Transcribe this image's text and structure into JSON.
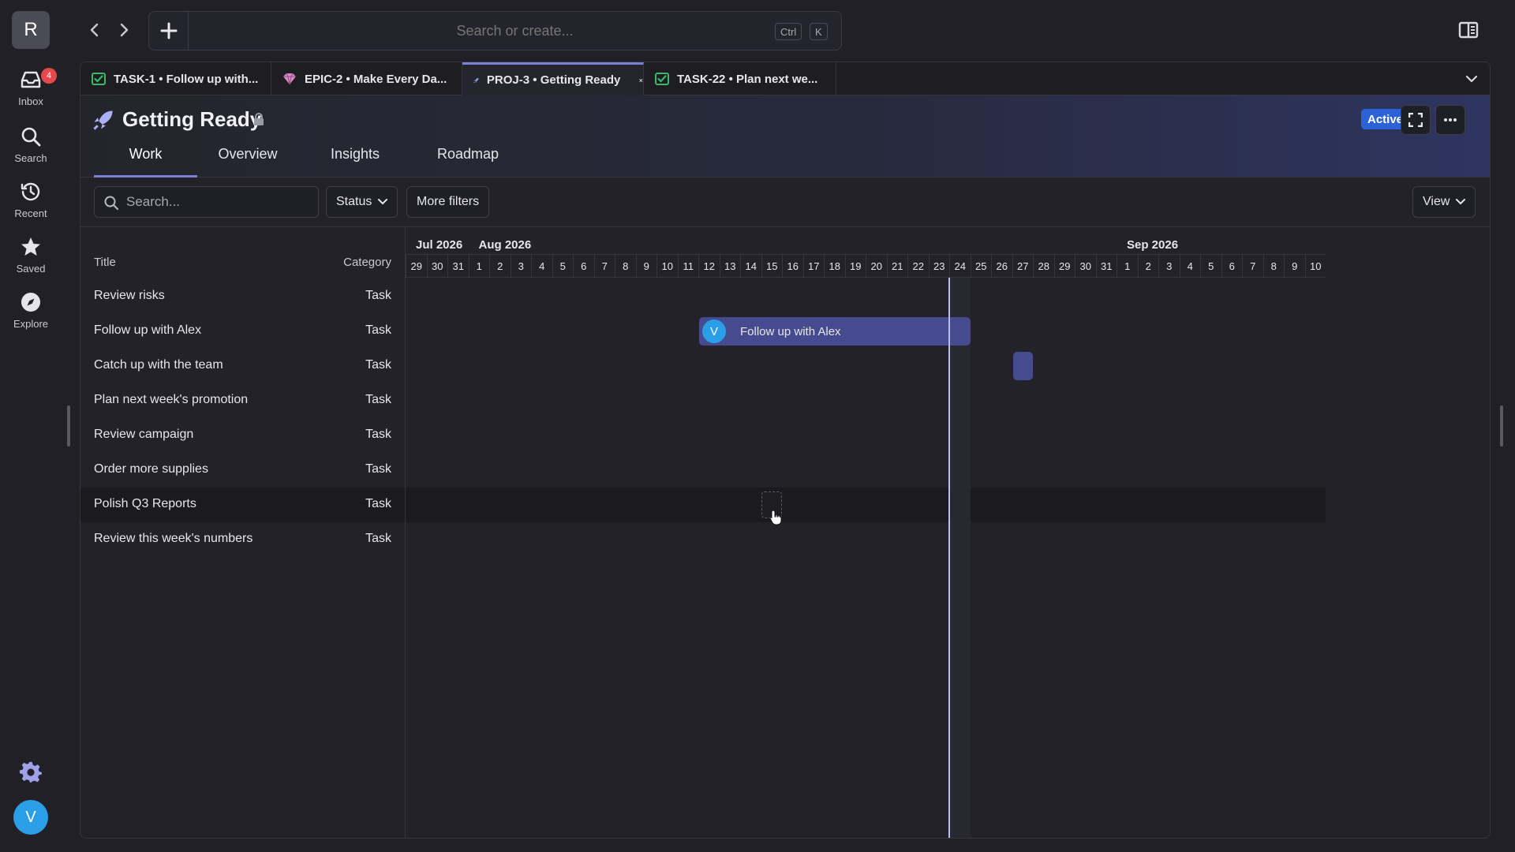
{
  "rail": {
    "workspace_initial": "R",
    "items": [
      {
        "label": "Inbox",
        "icon": "inbox-icon",
        "badge": "4"
      },
      {
        "label": "Search",
        "icon": "search-icon"
      },
      {
        "label": "Recent",
        "icon": "history-icon"
      },
      {
        "label": "Saved",
        "icon": "star-icon"
      },
      {
        "label": "Explore",
        "icon": "compass-icon"
      }
    ],
    "user_initial": "V"
  },
  "topbar": {
    "search_placeholder": "Search or create...",
    "shortcut_keys": [
      "Ctrl",
      "K"
    ]
  },
  "tabs": [
    {
      "label": "TASK-1 • Follow up with...",
      "icon": "task-icon"
    },
    {
      "label": "EPIC-2 • Make Every Da...",
      "icon": "epic-icon"
    },
    {
      "label": "PROJ-3 • Getting Ready",
      "icon": "rocket-icon",
      "active": true
    },
    {
      "label": "TASK-22 • Plan next we...",
      "icon": "task-icon"
    }
  ],
  "project": {
    "title": "Getting Ready",
    "status": "Active",
    "tabs": [
      "Work",
      "Overview",
      "Insights",
      "Roadmap"
    ],
    "active_tab": "Work"
  },
  "filters": {
    "search_placeholder": "Search...",
    "status_label": "Status",
    "more_filters_label": "More filters",
    "view_label": "View"
  },
  "list": {
    "columns": {
      "title": "Title",
      "category": "Category"
    },
    "rows": [
      {
        "title": "Review risks",
        "category": "Task"
      },
      {
        "title": "Follow up with Alex",
        "category": "Task"
      },
      {
        "title": "Catch up with the team",
        "category": "Task"
      },
      {
        "title": "Plan next week's promotion",
        "category": "Task"
      },
      {
        "title": "Review campaign",
        "category": "Task"
      },
      {
        "title": "Order more supplies",
        "category": "Task"
      },
      {
        "title": "Polish Q3 Reports",
        "category": "Task",
        "highlighted": true
      },
      {
        "title": "Review this week's numbers",
        "category": "Task"
      }
    ]
  },
  "timeline": {
    "months": [
      {
        "label": "Jul 2026",
        "start_index": 0
      },
      {
        "label": "Aug 2026",
        "start_index": 3
      },
      {
        "label": "Sep 2026",
        "start_index": 34
      }
    ],
    "days": [
      "29",
      "30",
      "31",
      "1",
      "2",
      "3",
      "4",
      "5",
      "6",
      "7",
      "8",
      "9",
      "10",
      "11",
      "12",
      "13",
      "14",
      "15",
      "16",
      "17",
      "18",
      "19",
      "20",
      "21",
      "22",
      "23",
      "24",
      "25",
      "26",
      "27",
      "28",
      "29",
      "30",
      "31",
      "1",
      "2",
      "3",
      "4",
      "5",
      "6",
      "7",
      "8",
      "9",
      "10"
    ],
    "today_index": 26,
    "bars": [
      {
        "row": 1,
        "start_index": 14,
        "end_index": 27,
        "label": "Follow up with Alex",
        "assignee_initial": "V"
      },
      {
        "row": 2,
        "start_index": 29,
        "end_index": 30,
        "label": ""
      }
    ],
    "placeholder": {
      "row": 6,
      "day_index": 17
    },
    "accent_color": "#464a8e"
  }
}
